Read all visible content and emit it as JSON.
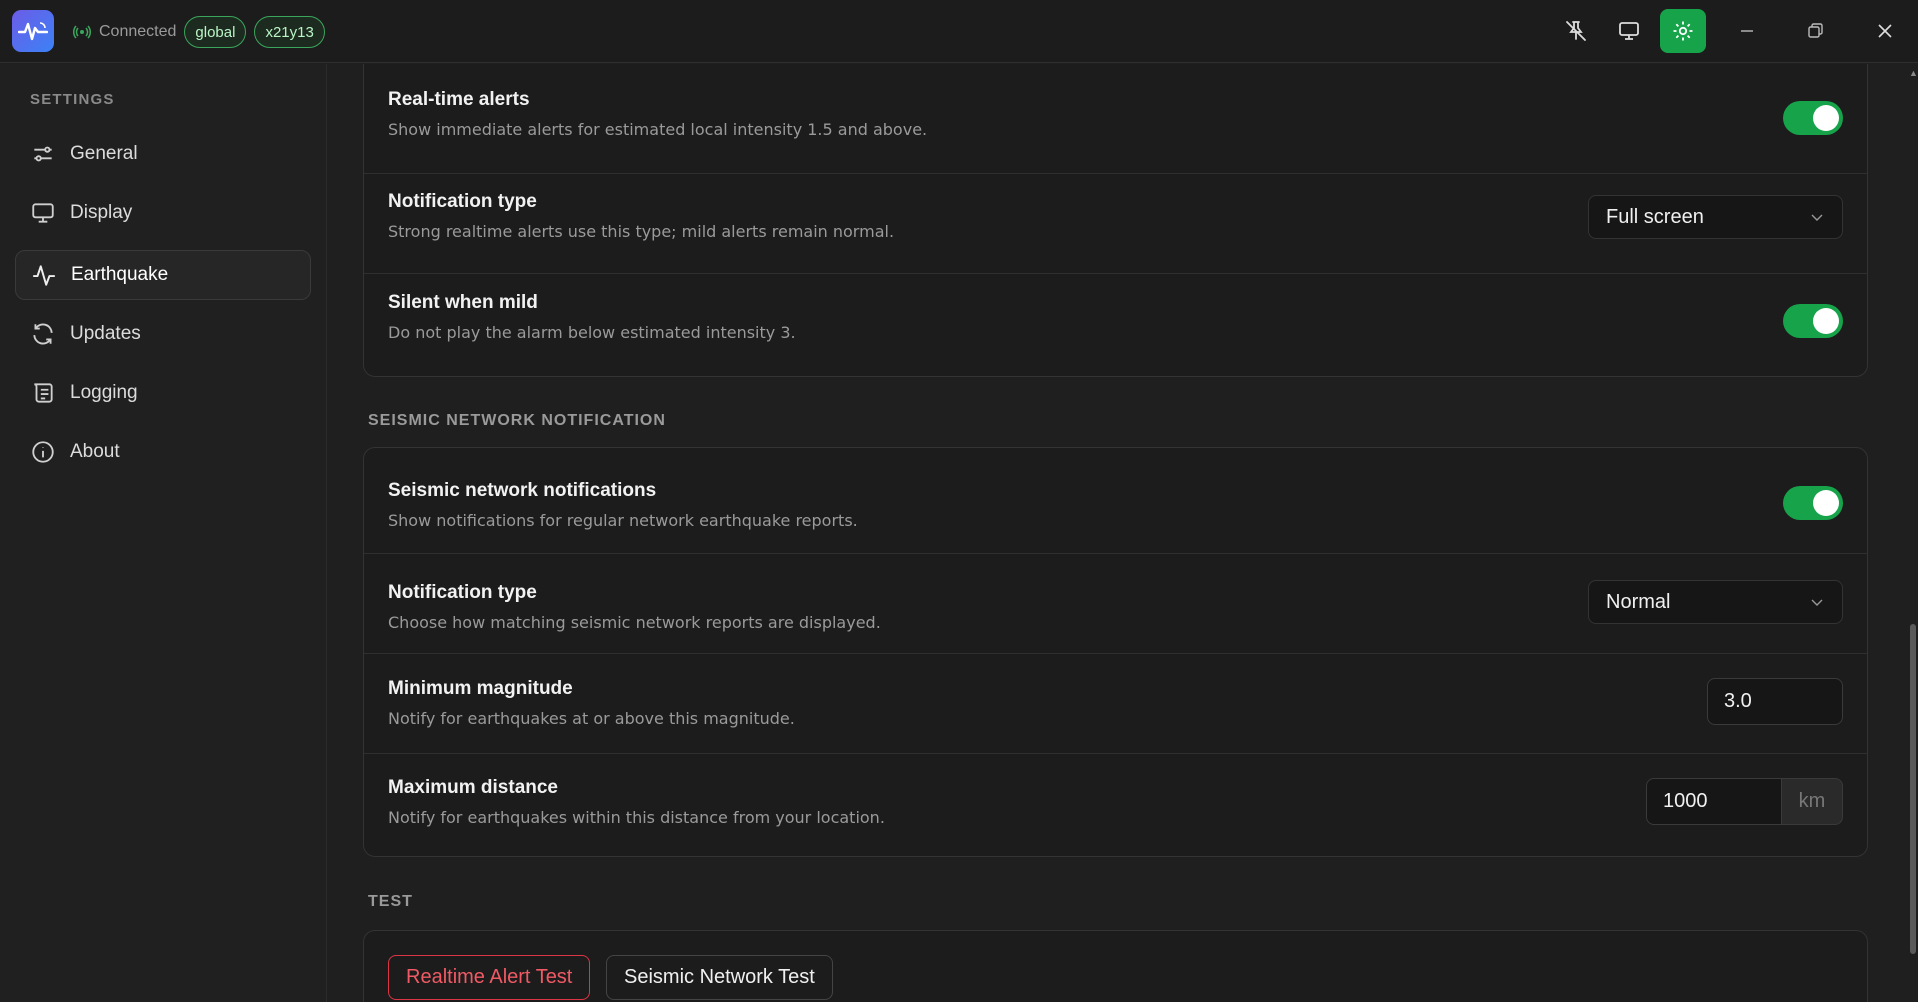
{
  "titlebar": {
    "status_text": "Connected",
    "badges": [
      "global",
      "x21y13"
    ],
    "icons": [
      "pin-off-icon",
      "monitor-icon",
      "gear-icon",
      "minimize-icon",
      "restore-icon",
      "close-icon"
    ],
    "accent_color": "#16a34a"
  },
  "sidebar": {
    "heading": "SETTINGS",
    "items": [
      {
        "label": "General",
        "icon": "sliders-icon"
      },
      {
        "label": "Display",
        "icon": "monitor-icon"
      },
      {
        "label": "Earthquake",
        "icon": "activity-icon",
        "selected": true
      },
      {
        "label": "Updates",
        "icon": "refresh-icon"
      },
      {
        "label": "Logging",
        "icon": "scroll-icon"
      },
      {
        "label": "About",
        "icon": "info-icon"
      }
    ]
  },
  "realtime": {
    "alerts_title": "Real-time alerts",
    "alerts_desc": "Show immediate alerts for estimated local intensity 1.5 and above.",
    "alerts_on": true,
    "type_title": "Notification type",
    "type_desc": "Strong realtime alerts use this type; mild alerts remain normal.",
    "type_value": "Full screen",
    "silent_title": "Silent when mild",
    "silent_desc": "Do not play the alarm below estimated intensity 3.",
    "silent_on": true
  },
  "seismic": {
    "heading": "SEISMIC NETWORK NOTIFICATION",
    "notif_title": "Seismic network notifications",
    "notif_desc": "Show notifications for regular network earthquake reports.",
    "notif_on": true,
    "type_title": "Notification type",
    "type_desc": "Choose how matching seismic network reports are displayed.",
    "type_value": "Normal",
    "mag_title": "Minimum magnitude",
    "mag_desc": "Notify for earthquakes at or above this magnitude.",
    "mag_value": "3.0",
    "dist_title": "Maximum distance",
    "dist_desc": "Notify for earthquakes within this distance from your location.",
    "dist_value": "1000",
    "dist_unit": "km"
  },
  "test": {
    "heading": "TEST",
    "realtime_button": "Realtime Alert Test",
    "network_button": "Seismic Network Test"
  }
}
